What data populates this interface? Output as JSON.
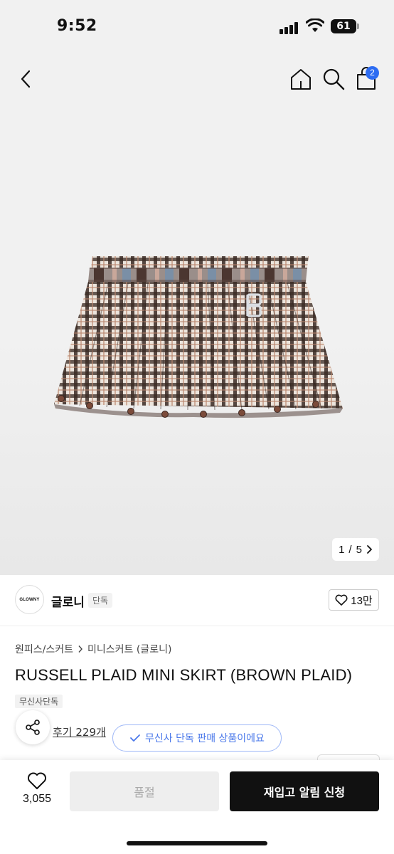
{
  "status_bar": {
    "time": "9:52",
    "battery": "61",
    "icons": [
      "signal-icon",
      "wifi-icon",
      "battery-icon"
    ]
  },
  "nav": {
    "icons": [
      "back-chevron-icon",
      "home-icon",
      "search-icon",
      "cart-icon"
    ],
    "cart_count": "2"
  },
  "gallery": {
    "current": "1",
    "separator": "/",
    "total": "5",
    "next_icon": "chevron-right-icon",
    "image_subject": "plaid pleated mini skirt"
  },
  "brand": {
    "logo_text": "GLOWNY",
    "name": "글로니",
    "tag": "단독",
    "like_count": "13만"
  },
  "product": {
    "breadcrumb": [
      "원피스/스커트",
      "미니스커트 (글로니)"
    ],
    "title": "RUSSELL PLAID MINI SKIRT (BROWN PLAID)",
    "badge": "무신사단독",
    "reviews_link": "후기 229개",
    "exclusive_notice": "무신사 단독 판매 상품이에요"
  },
  "bottom_bar": {
    "wish_count": "3,055",
    "soldout_label": "품절",
    "restock_label": "재입고 알림 신청"
  },
  "colors": {
    "accent_blue": "#2d6cf2",
    "pill_blue": "#4a78ea",
    "dark_button": "#111111",
    "disabled_button": "#eeeeee"
  }
}
